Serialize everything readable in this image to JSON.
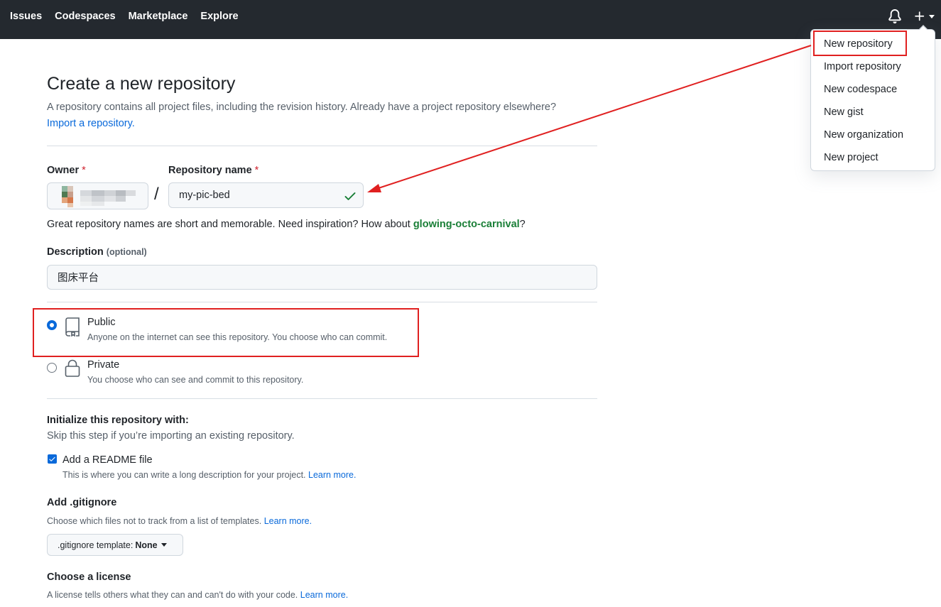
{
  "header": {
    "nav": [
      "Issues",
      "Codespaces",
      "Marketplace",
      "Explore"
    ],
    "icons": {
      "bell": "bell-icon",
      "plus": "plus-icon"
    }
  },
  "menu": {
    "items": [
      "New repository",
      "Import repository",
      "New codespace",
      "New gist",
      "New organization",
      "New project"
    ]
  },
  "page": {
    "title": "Create a new repository",
    "subtitle": "A repository contains all project files, including the revision history. Already have a project repository elsewhere?",
    "import_link": "Import a repository."
  },
  "form": {
    "owner_label": "Owner",
    "repo_label": "Repository name",
    "required_mark": "*",
    "slash": "/",
    "repo_name": "my-pic-bed",
    "hint_prefix": "Great repository names are short and memorable. Need inspiration? How about ",
    "hint_suggestion": "glowing-octo-carnival",
    "hint_suffix": "?",
    "description_label": "Description",
    "description_optional": "(optional)",
    "description_value": "图床平台"
  },
  "visibility": {
    "public_title": "Public",
    "public_desc": "Anyone on the internet can see this repository. You choose who can commit.",
    "private_title": "Private",
    "private_desc": "You choose who can see and commit to this repository.",
    "selected": "Public"
  },
  "init": {
    "title": "Initialize this repository with:",
    "subtitle": "Skip this step if you’re importing an existing repository.",
    "readme_label": "Add a README file",
    "readme_checked": true,
    "readme_desc": "This is where you can write a long description for your project.",
    "learn_more": "Learn more."
  },
  "gitignore": {
    "title": "Add .gitignore",
    "desc": "Choose which files not to track from a list of templates.",
    "learn_more": "Learn more.",
    "button_prefix": ".gitignore template:",
    "button_value": "None"
  },
  "license": {
    "title": "Choose a license",
    "desc": "A license tells others what they can and can't do with your code.",
    "learn_more": "Learn more."
  },
  "colors": {
    "header_bg": "#24292f",
    "link": "#0969da",
    "success": "#1a7f37",
    "annotation": "#e02020"
  }
}
